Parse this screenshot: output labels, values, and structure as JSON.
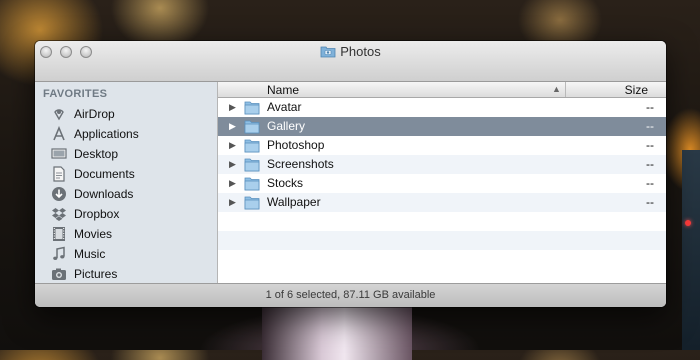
{
  "window": {
    "title": "Photos"
  },
  "sidebar": {
    "section": "FAVORITES",
    "items": [
      {
        "label": "AirDrop",
        "icon": "airdrop-icon"
      },
      {
        "label": "Applications",
        "icon": "applications-icon"
      },
      {
        "label": "Desktop",
        "icon": "desktop-icon"
      },
      {
        "label": "Documents",
        "icon": "documents-icon"
      },
      {
        "label": "Downloads",
        "icon": "downloads-icon"
      },
      {
        "label": "Dropbox",
        "icon": "dropbox-icon"
      },
      {
        "label": "Movies",
        "icon": "movies-icon"
      },
      {
        "label": "Music",
        "icon": "music-icon"
      },
      {
        "label": "Pictures",
        "icon": "pictures-icon"
      }
    ]
  },
  "columns": {
    "name": "Name",
    "size": "Size"
  },
  "rows": [
    {
      "name": "Avatar",
      "size": "--",
      "selected": false
    },
    {
      "name": "Gallery",
      "size": "--",
      "selected": true
    },
    {
      "name": "Photoshop",
      "size": "--",
      "selected": false
    },
    {
      "name": "Screenshots",
      "size": "--",
      "selected": false
    },
    {
      "name": "Stocks",
      "size": "--",
      "selected": false
    },
    {
      "name": "Wallpaper",
      "size": "--",
      "selected": false
    }
  ],
  "status": {
    "text": "1 of 6 selected, 87.11 GB available"
  },
  "colors": {
    "selection": "#7f8c9b",
    "sidebar": "#dee4ea"
  }
}
